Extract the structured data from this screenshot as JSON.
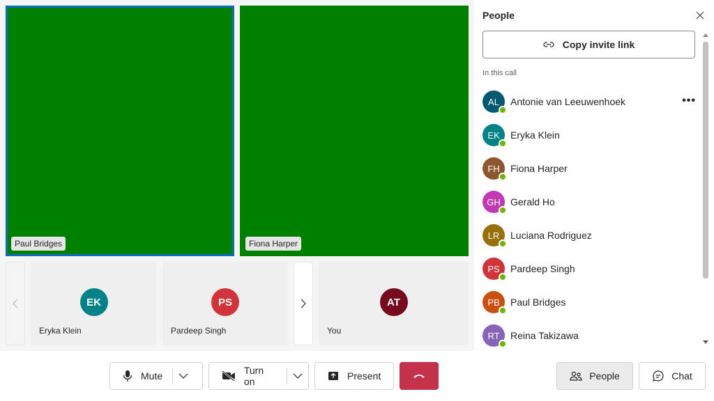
{
  "stage": {
    "tiles": [
      {
        "name": "Paul Bridges",
        "active": true
      },
      {
        "name": "Fiona Harper",
        "active": false
      }
    ],
    "strip": [
      {
        "initials": "EK",
        "name": "Eryka Klein",
        "color": "#038387"
      },
      {
        "initials": "PS",
        "name": "Pardeep Singh",
        "color": "#d13438"
      }
    ],
    "self": {
      "initials": "AT",
      "name": "You",
      "color": "#750b1c"
    }
  },
  "controls": {
    "mute_label": "Mute",
    "camera_label": "Turn on",
    "present_label": "Present",
    "people_label": "People",
    "chat_label": "Chat"
  },
  "panel": {
    "title": "People",
    "invite_label": "Copy invite link",
    "section_label": "In this call",
    "people": [
      {
        "initials": "AL",
        "name": "Antonie van Leeuwenhoek",
        "color": "#005b70",
        "more": true
      },
      {
        "initials": "EK",
        "name": "Eryka Klein",
        "color": "#038387"
      },
      {
        "initials": "FH",
        "name": "Fiona Harper",
        "color": "#8e562e"
      },
      {
        "initials": "GH",
        "name": "Gerald Ho",
        "color": "#c239b3"
      },
      {
        "initials": "LR",
        "name": "Luciana Rodriguez",
        "color": "#986f0b"
      },
      {
        "initials": "PS",
        "name": "Pardeep Singh",
        "color": "#d13438"
      },
      {
        "initials": "PB",
        "name": "Paul Bridges",
        "color": "#ca5010"
      },
      {
        "initials": "RT",
        "name": "Reina Takizawa",
        "color": "#8764b8"
      }
    ]
  },
  "colors": {
    "video_bg": "#008000",
    "accent": "#0f6cbd",
    "hangup": "#c4314b",
    "presence": "#6bb700"
  }
}
